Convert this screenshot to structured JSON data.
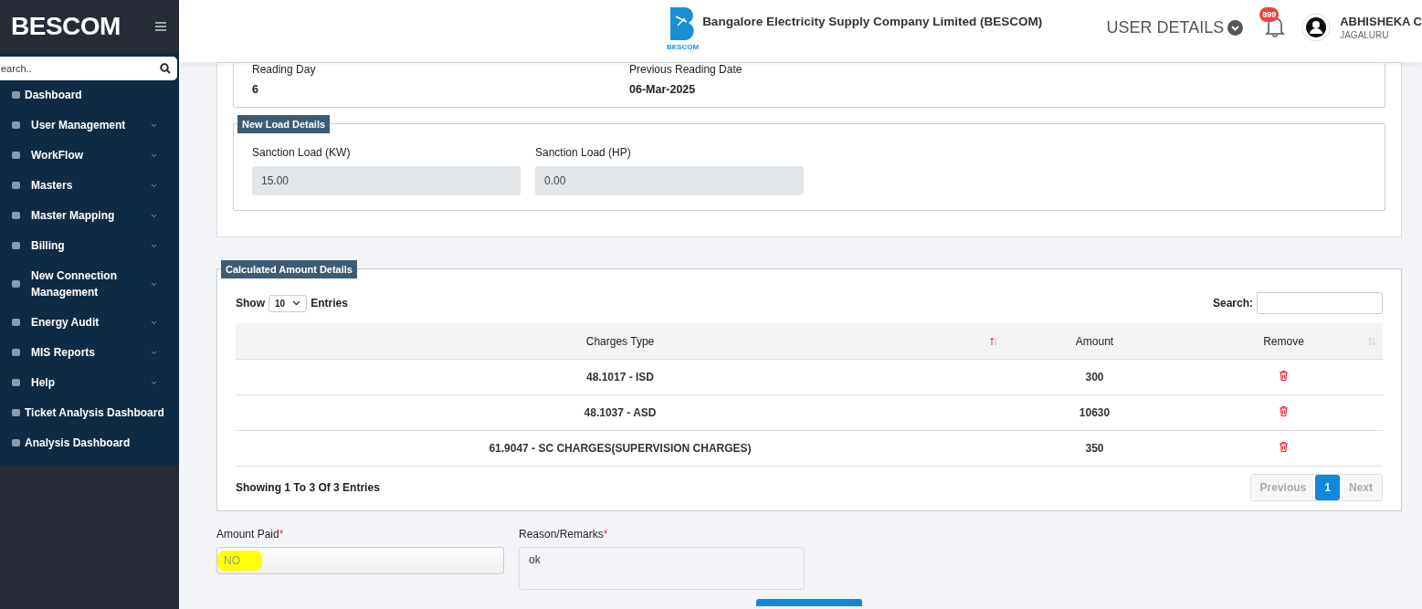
{
  "sidebar": {
    "brand": "BESCOM",
    "search": {
      "placeholder": "earch.."
    },
    "items": [
      {
        "label": "Dashboard",
        "expandable": false
      },
      {
        "label": "User Management",
        "expandable": true
      },
      {
        "label": "WorkFlow",
        "expandable": true
      },
      {
        "label": "Masters",
        "expandable": true
      },
      {
        "label": "Master Mapping",
        "expandable": true
      },
      {
        "label": "Billing",
        "expandable": true
      },
      {
        "label": "New Connection Management",
        "expandable": true
      },
      {
        "label": "Energy Audit",
        "expandable": true
      },
      {
        "label": "MIS Reports",
        "expandable": true
      },
      {
        "label": "Help",
        "expandable": true
      },
      {
        "label": "Ticket Analysis Dashboard",
        "expandable": false
      },
      {
        "label": "Analysis Dashboard",
        "expandable": false
      }
    ]
  },
  "header": {
    "logo_text": "BESCOM",
    "company": "Bangalore Electricity Supply Company Limited (BESCOM)",
    "user_details": "USER DETAILS",
    "notifications": "899",
    "user": {
      "name": "ABHISHEKA C",
      "location": "JAGALURU"
    }
  },
  "reading": {
    "fields": [
      {
        "label": "Reading Day",
        "value": "6"
      },
      {
        "label": "Previous Reading Date",
        "value": "06-Mar-2025"
      }
    ]
  },
  "new_load": {
    "title": "New Load Details",
    "fields": [
      {
        "label": "Sanction Load (KW)",
        "value": "15.00"
      },
      {
        "label": "Sanction Load (HP)",
        "value": "0.00"
      }
    ]
  },
  "calculated": {
    "title": "Calculated Amount Details",
    "show": "Show",
    "page_size": "10",
    "entries": "Entries",
    "search_label": "Search:",
    "columns": [
      "Charges Type",
      "Amount",
      "Remove"
    ],
    "rows": [
      {
        "charges_type": "48.1017 - ISD",
        "amount": "300"
      },
      {
        "charges_type": "48.1037 - ASD",
        "amount": "10630"
      },
      {
        "charges_type": "61.9047 - SC CHARGES(SUPERVISION CHARGES)",
        "amount": "350"
      }
    ],
    "info": "Showing 1 To 3 Of 3 Entries",
    "pagination": [
      {
        "label": "Previous",
        "selected": false,
        "disabled": true
      },
      {
        "label": "1",
        "selected": true,
        "disabled": false
      },
      {
        "label": "Next",
        "selected": false,
        "disabled": true
      }
    ]
  },
  "amount_paid": {
    "label": "Amount Paid",
    "required_mark": "*",
    "value": "NO",
    "highlighted": true
  },
  "remarks": {
    "label": "Reason/Remarks",
    "required_mark": "*",
    "value": "ok"
  }
}
